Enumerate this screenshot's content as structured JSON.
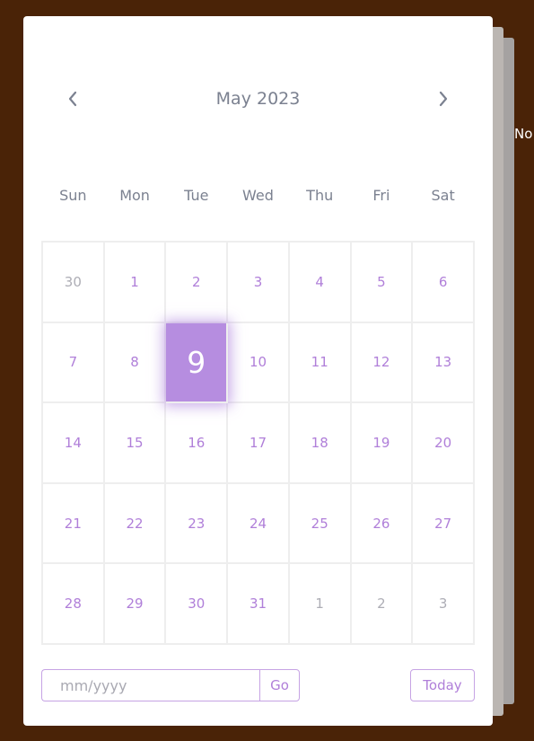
{
  "background": {
    "peek_text": "No"
  },
  "calendar": {
    "month_title": "May 2023",
    "prev_icon": "chevron-left-icon",
    "next_icon": "chevron-right-icon",
    "weekdays": [
      "Sun",
      "Mon",
      "Tue",
      "Wed",
      "Thu",
      "Fri",
      "Sat"
    ],
    "weeks": [
      [
        {
          "label": "30",
          "in_month": false,
          "selected": false
        },
        {
          "label": "1",
          "in_month": true,
          "selected": false
        },
        {
          "label": "2",
          "in_month": true,
          "selected": false
        },
        {
          "label": "3",
          "in_month": true,
          "selected": false
        },
        {
          "label": "4",
          "in_month": true,
          "selected": false
        },
        {
          "label": "5",
          "in_month": true,
          "selected": false
        },
        {
          "label": "6",
          "in_month": true,
          "selected": false
        }
      ],
      [
        {
          "label": "7",
          "in_month": true,
          "selected": false
        },
        {
          "label": "8",
          "in_month": true,
          "selected": false
        },
        {
          "label": "9",
          "in_month": true,
          "selected": true
        },
        {
          "label": "10",
          "in_month": true,
          "selected": false
        },
        {
          "label": "11",
          "in_month": true,
          "selected": false
        },
        {
          "label": "12",
          "in_month": true,
          "selected": false
        },
        {
          "label": "13",
          "in_month": true,
          "selected": false
        }
      ],
      [
        {
          "label": "14",
          "in_month": true,
          "selected": false
        },
        {
          "label": "15",
          "in_month": true,
          "selected": false
        },
        {
          "label": "16",
          "in_month": true,
          "selected": false
        },
        {
          "label": "17",
          "in_month": true,
          "selected": false
        },
        {
          "label": "18",
          "in_month": true,
          "selected": false
        },
        {
          "label": "19",
          "in_month": true,
          "selected": false
        },
        {
          "label": "20",
          "in_month": true,
          "selected": false
        }
      ],
      [
        {
          "label": "21",
          "in_month": true,
          "selected": false
        },
        {
          "label": "22",
          "in_month": true,
          "selected": false
        },
        {
          "label": "23",
          "in_month": true,
          "selected": false
        },
        {
          "label": "24",
          "in_month": true,
          "selected": false
        },
        {
          "label": "25",
          "in_month": true,
          "selected": false
        },
        {
          "label": "26",
          "in_month": true,
          "selected": false
        },
        {
          "label": "27",
          "in_month": true,
          "selected": false
        }
      ],
      [
        {
          "label": "28",
          "in_month": true,
          "selected": false
        },
        {
          "label": "29",
          "in_month": true,
          "selected": false
        },
        {
          "label": "30",
          "in_month": true,
          "selected": false
        },
        {
          "label": "31",
          "in_month": true,
          "selected": false
        },
        {
          "label": "1",
          "in_month": false,
          "selected": false
        },
        {
          "label": "2",
          "in_month": false,
          "selected": false
        },
        {
          "label": "3",
          "in_month": false,
          "selected": false
        }
      ]
    ],
    "footer": {
      "input_value": "",
      "input_placeholder": "mm/yyyy",
      "go_label": "Go",
      "today_label": "Today"
    },
    "colors": {
      "accent": "#b07fd9",
      "selected_bg": "#b68de0",
      "muted": "#adadb5",
      "text": "#7b8190",
      "backdrop": "#4a2307"
    }
  }
}
